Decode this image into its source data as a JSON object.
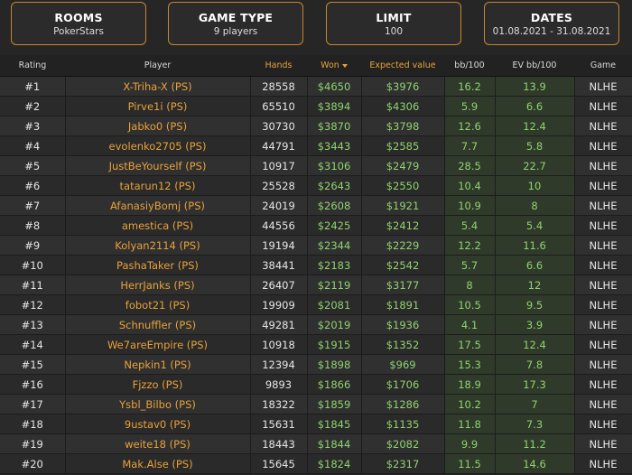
{
  "filters": [
    {
      "title": "ROOMS",
      "value": "PokerStars"
    },
    {
      "title": "GAME TYPE",
      "value": "9 players"
    },
    {
      "title": "LIMIT",
      "value": "100"
    },
    {
      "title": "DATES",
      "value": "01.08.2021 - 31.08.2021"
    }
  ],
  "columns": {
    "rating": "Rating",
    "player": "Player",
    "hands": "Hands",
    "won": "Won",
    "expected": "Expected value",
    "bb100": "bb/100",
    "evbb100": "EV bb/100",
    "game": "Game"
  },
  "sort_column": "won",
  "colors": {
    "accent": "#e8a13a",
    "positive": "#8fd36f",
    "background": "#262626"
  },
  "rows": [
    [
      "#1",
      "X-Triha-X (PS)",
      "28558",
      "$4650",
      "$3976",
      "16.2",
      "13.9",
      "NLHE"
    ],
    [
      "#2",
      "Pirve1i (PS)",
      "65510",
      "$3894",
      "$4306",
      "5.9",
      "6.6",
      "NLHE"
    ],
    [
      "#3",
      "Jabko0 (PS)",
      "30730",
      "$3870",
      "$3798",
      "12.6",
      "12.4",
      "NLHE"
    ],
    [
      "#4",
      "evolenko2705 (PS)",
      "44791",
      "$3443",
      "$2585",
      "7.7",
      "5.8",
      "NLHE"
    ],
    [
      "#5",
      "JustBeYourself (PS)",
      "10917",
      "$3106",
      "$2479",
      "28.5",
      "22.7",
      "NLHE"
    ],
    [
      "#6",
      "tatarun12 (PS)",
      "25528",
      "$2643",
      "$2550",
      "10.4",
      "10",
      "NLHE"
    ],
    [
      "#7",
      "AfanasiyBomj (PS)",
      "24019",
      "$2608",
      "$1921",
      "10.9",
      "8",
      "NLHE"
    ],
    [
      "#8",
      "amestica (PS)",
      "44556",
      "$2425",
      "$2412",
      "5.4",
      "5.4",
      "NLHE"
    ],
    [
      "#9",
      "Kolyan2114 (PS)",
      "19194",
      "$2344",
      "$2229",
      "12.2",
      "11.6",
      "NLHE"
    ],
    [
      "#10",
      "PashaTaker (PS)",
      "38441",
      "$2183",
      "$2542",
      "5.7",
      "6.6",
      "NLHE"
    ],
    [
      "#11",
      "HerrJanks (PS)",
      "26407",
      "$2119",
      "$3177",
      "8",
      "12",
      "NLHE"
    ],
    [
      "#12",
      "fobot21 (PS)",
      "19909",
      "$2081",
      "$1891",
      "10.5",
      "9.5",
      "NLHE"
    ],
    [
      "#13",
      "Schnuffler (PS)",
      "49281",
      "$2019",
      "$1936",
      "4.1",
      "3.9",
      "NLHE"
    ],
    [
      "#14",
      "We7areEmpire (PS)",
      "10918",
      "$1915",
      "$1352",
      "17.5",
      "12.4",
      "NLHE"
    ],
    [
      "#15",
      "Nepkin1 (PS)",
      "12394",
      "$1898",
      "$969",
      "15.3",
      "7.8",
      "NLHE"
    ],
    [
      "#16",
      "Fjzzo (PS)",
      "9893",
      "$1866",
      "$1706",
      "18.9",
      "17.3",
      "NLHE"
    ],
    [
      "#17",
      "Ysbl_Bilbo (PS)",
      "18322",
      "$1859",
      "$1286",
      "10.2",
      "7",
      "NLHE"
    ],
    [
      "#18",
      "9ustav0 (PS)",
      "15631",
      "$1845",
      "$1135",
      "11.8",
      "7.3",
      "NLHE"
    ],
    [
      "#19",
      "weite18 (PS)",
      "18443",
      "$1844",
      "$2082",
      "9.9",
      "11.2",
      "NLHE"
    ],
    [
      "#20",
      "Mak.Alse (PS)",
      "15645",
      "$1824",
      "$2317",
      "11.5",
      "14.6",
      "NLHE"
    ]
  ]
}
